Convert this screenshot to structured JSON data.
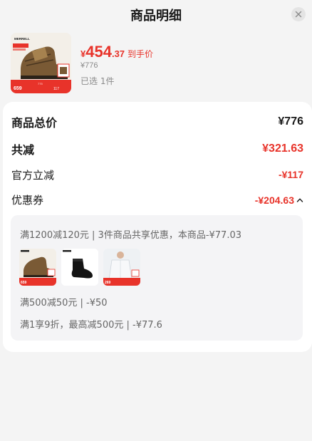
{
  "header": {
    "title": "商品明细"
  },
  "product": {
    "brand": "MERRELL",
    "thumb_badge_price": "659",
    "thumb_badge_orig": "775",
    "thumb_badge_save": "117",
    "price_currency": "¥",
    "price_integer": "454",
    "price_decimal": ".37",
    "price_tag": "到手价",
    "original_price": "¥776",
    "selected_text": "已选 1件"
  },
  "summary": {
    "total_label": "商品总价",
    "total_value": "¥776",
    "discount_label": "共减",
    "discount_value": "¥321.63",
    "official_label": "官方立减",
    "official_value": "-¥117",
    "coupon_label": "优惠券",
    "coupon_value": "-¥204.63"
  },
  "coupons": {
    "line1": "满1200减120元 | 3件商品共享优惠，本商品-¥77.03",
    "thumbs": [
      {
        "name": "boot",
        "badge": "659"
      },
      {
        "name": "sock",
        "badge": ""
      },
      {
        "name": "shirt",
        "badge": "269"
      }
    ],
    "line2": "满500减50元 | -¥50",
    "line3": "满1享9折，最高减500元 | -¥77.6"
  },
  "colors": {
    "accent": "#e8332a",
    "muted": "#8a8a8a",
    "panel": "#f4f4f6"
  },
  "icons": {
    "close": "close-icon",
    "chevron": "chevron-up-icon"
  }
}
